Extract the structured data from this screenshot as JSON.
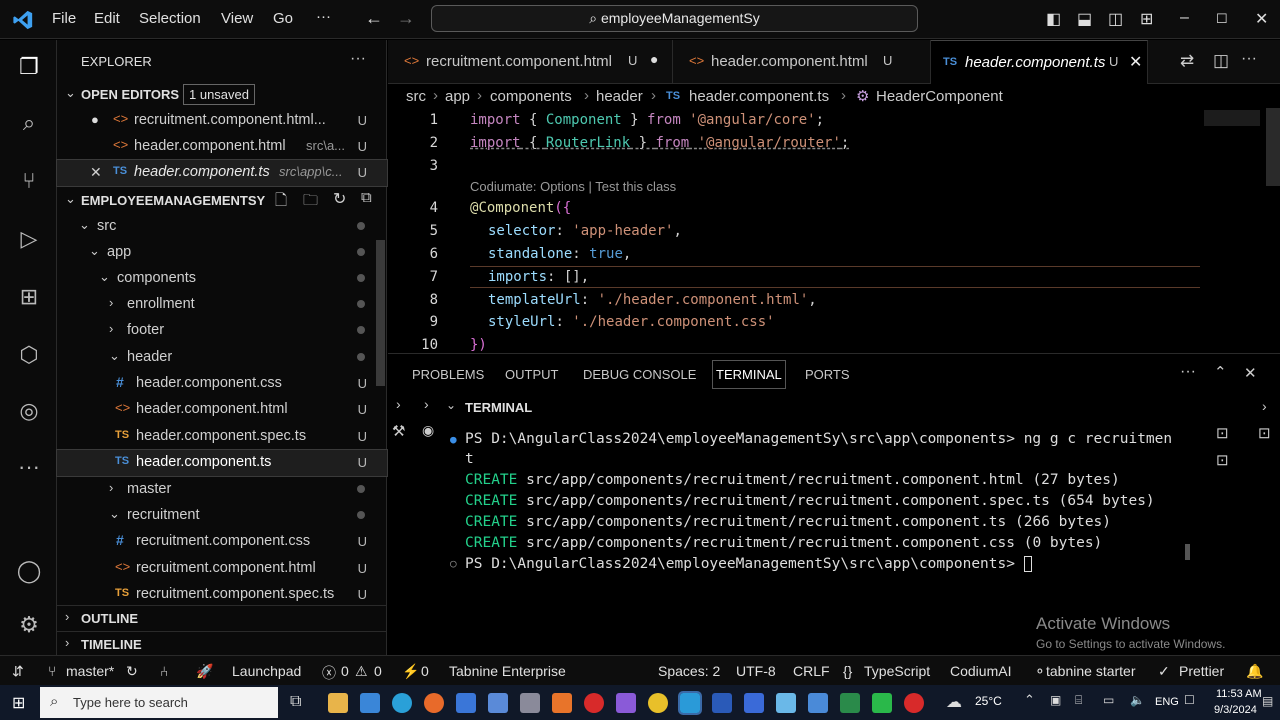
{
  "menu": {
    "file": "File",
    "edit": "Edit",
    "selection": "Selection",
    "view": "View",
    "go": "Go",
    "more": "···"
  },
  "search": {
    "text": "employeeManagementSy"
  },
  "sidebar": {
    "title": "EXPLORER",
    "open_editors": "OPEN EDITORS",
    "unsaved_badge": "1 unsaved",
    "open_files": [
      {
        "name": "recruitment.component.html...",
        "path": "",
        "status": "U"
      },
      {
        "name": "header.component.html",
        "path": "src\\a...",
        "status": "U"
      },
      {
        "name": "header.component.ts",
        "path": "src\\app\\c...",
        "status": "U"
      }
    ],
    "project": "EMPLOYEEMANAGEMENTSY",
    "tree": [
      {
        "label": "src"
      },
      {
        "label": "app"
      },
      {
        "label": "components"
      },
      {
        "label": "enrollment"
      },
      {
        "label": "footer"
      },
      {
        "label": "header"
      },
      {
        "label": "header.component.css",
        "status": "U"
      },
      {
        "label": "header.component.html",
        "status": "U"
      },
      {
        "label": "header.component.spec.ts",
        "status": "U"
      },
      {
        "label": "header.component.ts",
        "status": "U"
      },
      {
        "label": "master"
      },
      {
        "label": "recruitment"
      },
      {
        "label": "recruitment.component.css",
        "status": "U"
      },
      {
        "label": "recruitment.component.html",
        "status": "U"
      },
      {
        "label": "recruitment.component.spec.ts",
        "status": "U"
      }
    ],
    "outline": "OUTLINE",
    "timeline": "TIMELINE"
  },
  "tabs": [
    {
      "label": "recruitment.component.html",
      "status": "U"
    },
    {
      "label": "header.component.html",
      "status": "U"
    },
    {
      "label": "header.component.ts",
      "status": "U",
      "icon": "TS"
    }
  ],
  "breadcrumb": [
    "src",
    "app",
    "components",
    "header",
    "header.component.ts",
    "HeaderComponent"
  ],
  "code": {
    "line_numbers": [
      "1",
      "2",
      "3",
      "4",
      "5",
      "6",
      "7",
      "8",
      "9",
      "10"
    ],
    "codelens": "Codiumate: Options | Test this class",
    "l1": {
      "kw": "import",
      "a": " { ",
      "cls": "Component",
      "b": " } ",
      "kw2": "from",
      "str": " '@angular/core'",
      "end": ";"
    },
    "l2": {
      "kw": "import",
      "a": " { ",
      "cls": "RouterLink",
      "b": " } ",
      "kw2": "from",
      "str": " '@angular/router'",
      "end": ";"
    },
    "l4": {
      "at": "@",
      "fn": "Component",
      "rest": "({"
    },
    "l5": {
      "prop": "selector",
      "sep": ": ",
      "str": "'app-header'",
      "end": ","
    },
    "l6": {
      "prop": "standalone",
      "sep": ": ",
      "bool": "true",
      "end": ","
    },
    "l7": {
      "prop": "imports",
      "sep": ": ",
      "rest": "[],"
    },
    "l8": {
      "prop": "templateUrl",
      "sep": ": ",
      "str": "'./header.component.html'",
      "end": ","
    },
    "l9": {
      "prop": "styleUrl",
      "sep": ": ",
      "str": "'./header.component.css'"
    },
    "l10": {
      "rest": "})"
    }
  },
  "panel": {
    "tabs": [
      "PROBLEMS",
      "OUTPUT",
      "DEBUG CONSOLE",
      "TERMINAL",
      "PORTS"
    ],
    "terminal_label": "TERMINAL",
    "lines": [
      "PS D:\\AngularClass2024\\employeeManagementSy\\src\\app\\components> ng g c recruitmen",
      "t"
    ],
    "create_word": "CREATE",
    "creates": [
      " src/app/components/recruitment/recruitment.component.html (27 bytes)",
      " src/app/components/recruitment/recruitment.component.spec.ts (654 bytes)",
      " src/app/components/recruitment/recruitment.component.ts (266 bytes)",
      " src/app/components/recruitment/recruitment.component.css (0 bytes)"
    ],
    "prompt": "PS D:\\AngularClass2024\\employeeManagementSy\\src\\app\\components> "
  },
  "watermark": {
    "title": "Activate Windows",
    "subtitle": "Go to Settings to activate Windows."
  },
  "status": {
    "branch": "master*",
    "launchpad": "Launchpad",
    "errors": "0",
    "warnings": "0",
    "ports": "0",
    "tabnine": "Tabnine Enterprise",
    "spaces": "Spaces: 2",
    "encoding": "UTF-8",
    "eol": "CRLF",
    "language": "TypeScript",
    "codium": "CodiumAI",
    "tabnine_starter": "tabnine starter",
    "prettier": "Prettier"
  },
  "taskbar": {
    "search_placeholder": "Type here to search",
    "temp": "25°C",
    "lang": "ENG",
    "time": "11:53 AM",
    "date": "9/3/2024"
  }
}
